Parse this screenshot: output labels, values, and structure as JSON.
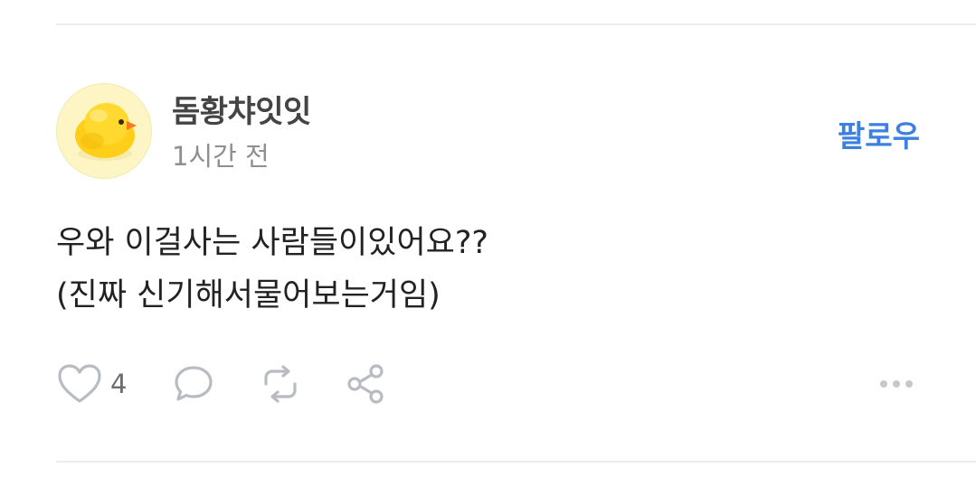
{
  "post": {
    "author": "돔황챠잇잇",
    "time": "1시간 전",
    "follow_label": "팔로우",
    "content_lines": [
      "우와 이걸사는 사람들이있어요??",
      "(진짜 신기해서물어보는거임)"
    ],
    "like_count": "4"
  },
  "icons": {
    "avatar": "yellow-chick-avatar",
    "like": "heart-icon",
    "comment": "comment-bubble-icon",
    "repost": "repost-icon",
    "share": "share-icon",
    "more": "more-dots-icon"
  },
  "colors": {
    "accent": "#3c80e0",
    "icon_gray": "#b8bcc2",
    "avatar_bg": "#fdf6c4",
    "chick_yellow": "#ffd21f",
    "beak_orange": "#ff7a1a"
  }
}
